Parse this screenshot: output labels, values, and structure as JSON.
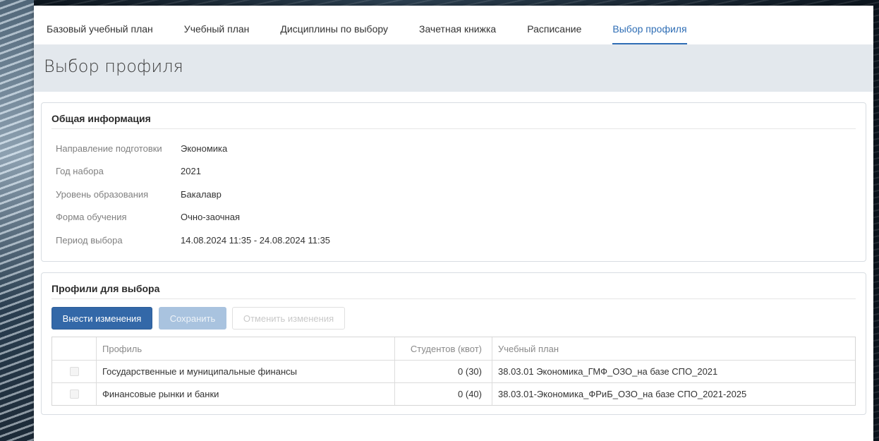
{
  "tabs": [
    {
      "label": "Базовый учебный план",
      "active": false
    },
    {
      "label": "Учебный план",
      "active": false
    },
    {
      "label": "Дисциплины по выбору",
      "active": false
    },
    {
      "label": "Зачетная книжка",
      "active": false
    },
    {
      "label": "Расписание",
      "active": false
    },
    {
      "label": "Выбор профиля",
      "active": true
    }
  ],
  "page": {
    "title": "Выбор профиля"
  },
  "general": {
    "title": "Общая информация",
    "rows": [
      {
        "label": "Направление подготовки",
        "value": "Экономика"
      },
      {
        "label": "Год набора",
        "value": "2021"
      },
      {
        "label": "Уровень образования",
        "value": "Бакалавр"
      },
      {
        "label": "Форма обучения",
        "value": "Очно-заочная"
      },
      {
        "label": "Период выбора",
        "value": "14.08.2024 11:35 - 24.08.2024 11:35"
      }
    ]
  },
  "profiles": {
    "title": "Профили для выбора",
    "buttons": {
      "edit": "Внести изменения",
      "save": "Сохранить",
      "cancel": "Отменить изменения"
    },
    "columns": {
      "profile": "Профиль",
      "students": "Студентов (квот)",
      "plan": "Учебный план"
    },
    "rows": [
      {
        "profile": "Государственные и муниципальные финансы",
        "students": "0 (30)",
        "plan": "38.03.01 Экономика_ГМФ_ОЗО_на базе СПО_2021",
        "checked": false
      },
      {
        "profile": "Финансовые рынки и банки",
        "students": "0 (40)",
        "plan": "38.03.01-Экономика_ФРиБ_ОЗО_на базе СПО_2021-2025",
        "checked": false
      }
    ]
  },
  "colors": {
    "accent": "#2f6eb5",
    "primary_button": "#3368a8",
    "header_band": "#e3e8ed"
  }
}
